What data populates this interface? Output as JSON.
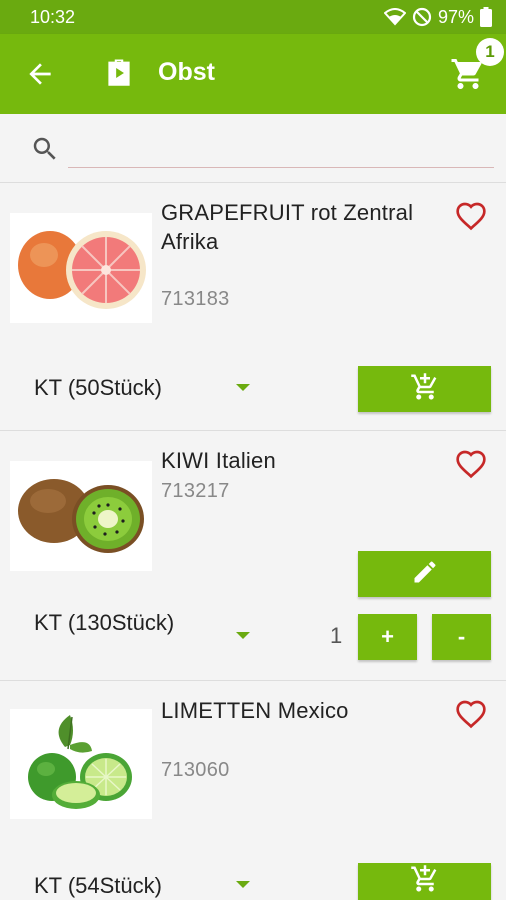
{
  "status_bar": {
    "time": "10:32",
    "battery": "97%"
  },
  "app_bar": {
    "title": "Obst",
    "cart_count": "1"
  },
  "search": {
    "placeholder": "",
    "value": ""
  },
  "colors": {
    "primary": "#76b90d",
    "heart": "#c62828"
  },
  "products": [
    {
      "name": "GRAPEFRUIT rot Zentral Afrika",
      "code": "713183",
      "unit": "KT (50Stück)",
      "favorite": false,
      "in_cart": false
    },
    {
      "name": "KIWI Italien",
      "code": "713217",
      "unit": "KT (130Stück)",
      "favorite": false,
      "in_cart": true,
      "quantity": "1",
      "plus_label": "+",
      "minus_label": "-"
    },
    {
      "name": "LIMETTEN Mexico",
      "code": "713060",
      "unit": "KT (54Stück)",
      "favorite": false,
      "in_cart": false
    }
  ]
}
